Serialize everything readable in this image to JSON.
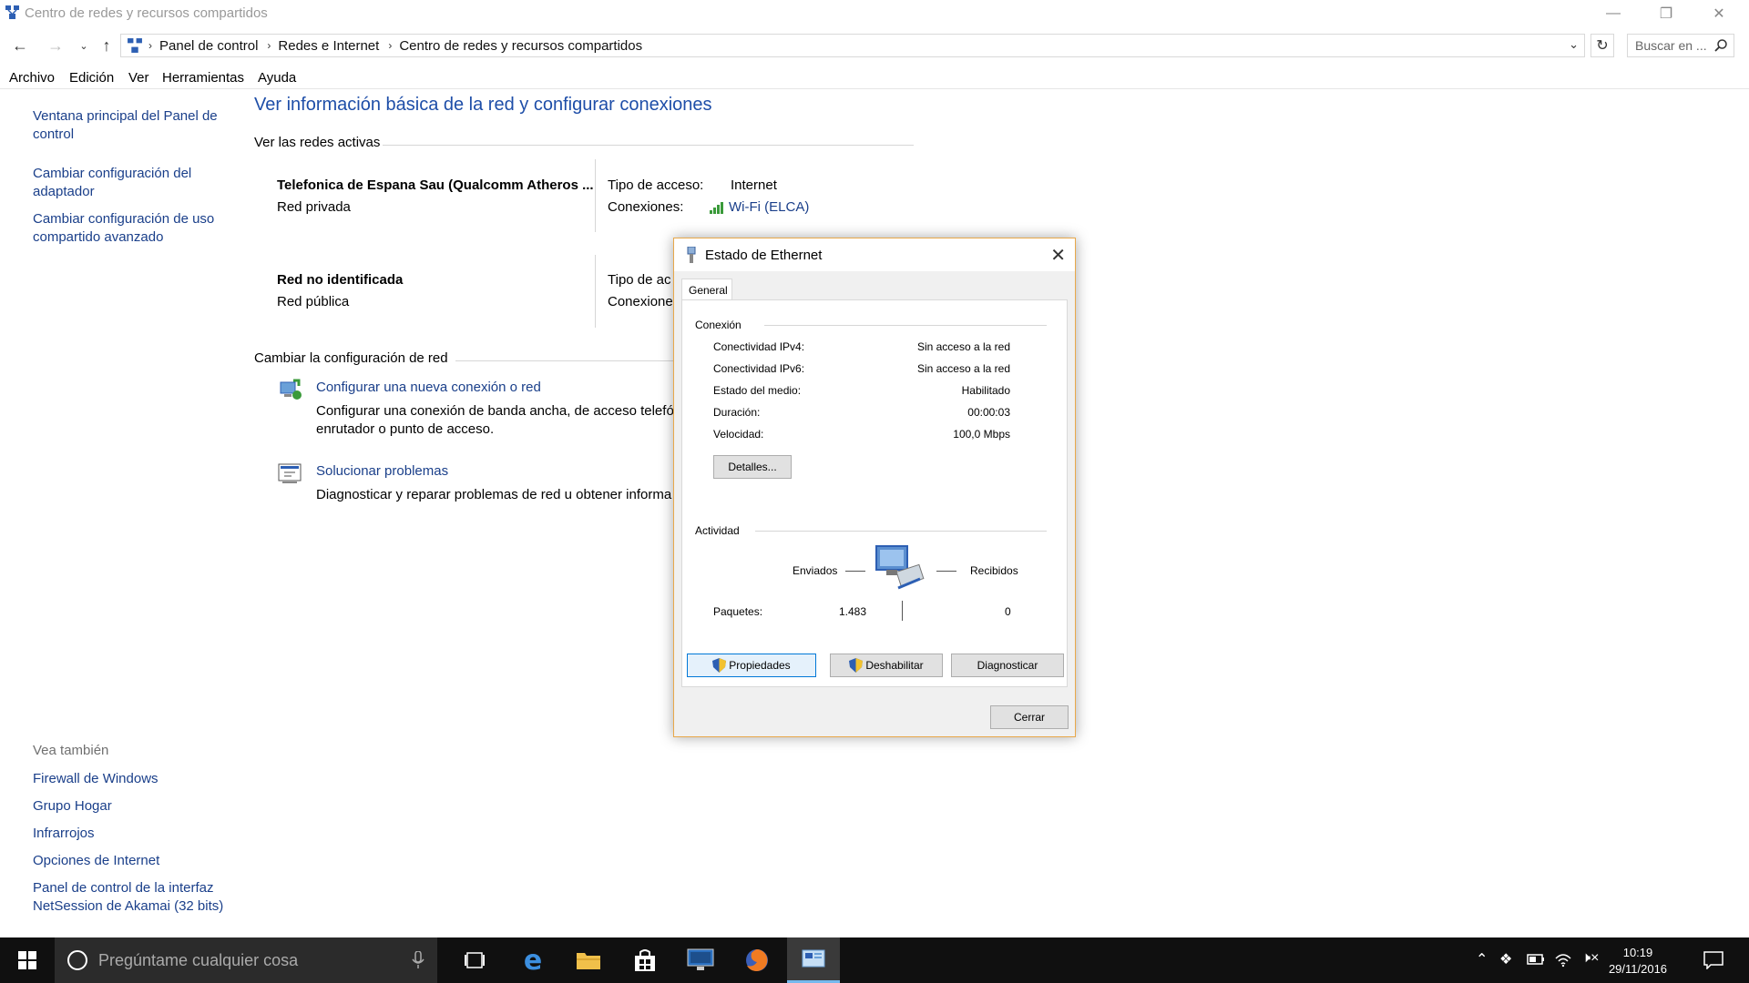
{
  "window": {
    "title": "Centro de redes y recursos compartidos"
  },
  "address": {
    "breadcrumbs": [
      "Panel de control",
      "Redes e Internet",
      "Centro de redes y recursos compartidos"
    ],
    "search_placeholder": "Buscar en ..."
  },
  "menu": [
    "Archivo",
    "Edición",
    "Ver",
    "Herramientas",
    "Ayuda"
  ],
  "sidebar": {
    "links": [
      "Ventana principal del Panel de control",
      "Cambiar configuración del adaptador",
      "Cambiar configuración de uso compartido avanzado"
    ],
    "see_also_label": "Vea también",
    "see_also": [
      "Firewall de Windows",
      "Grupo Hogar",
      "Infrarrojos",
      "Opciones de Internet",
      "Panel de control de la interfaz NetSession de Akamai (32 bits)"
    ]
  },
  "main": {
    "title": "Ver información básica de la red y configurar conexiones",
    "active_networks_header": "Ver las redes activas",
    "networks": [
      {
        "name": "Telefonica de Espana Sau (Qualcomm Atheros ...",
        "type": "Red privada",
        "access_label": "Tipo de acceso:",
        "access_value": "Internet",
        "connections_label": "Conexiones:",
        "connections_value": "Wi-Fi (ELCA)"
      },
      {
        "name": "Red no identificada",
        "type": "Red pública",
        "access_label": "Tipo de ac",
        "connections_label": "Conexiones"
      }
    ],
    "change_config_header": "Cambiar la configuración de red",
    "tasks": [
      {
        "link": "Configurar una nueva conexión o red",
        "desc_line1": "Configurar una conexión de banda ancha, de acceso telefó",
        "desc_line2": "enrutador o punto de acceso."
      },
      {
        "link": "Solucionar problemas",
        "desc_line1": "Diagnosticar y reparar problemas de red u obtener informa"
      }
    ]
  },
  "dialog": {
    "title": "Estado de Ethernet",
    "tab": "General",
    "connection_group": "Conexión",
    "rows": [
      {
        "label": "Conectividad IPv4:",
        "value": "Sin acceso a la red"
      },
      {
        "label": "Conectividad IPv6:",
        "value": "Sin acceso a la red"
      },
      {
        "label": "Estado del medio:",
        "value": "Habilitado"
      },
      {
        "label": "Duración:",
        "value": "00:00:03"
      },
      {
        "label": "Velocidad:",
        "value": "100,0 Mbps"
      }
    ],
    "details_button": "Detalles...",
    "activity_group": "Actividad",
    "sent_label": "Enviados",
    "received_label": "Recibidos",
    "packets_label": "Paquetes:",
    "packets_sent": "1.483",
    "packets_received": "0",
    "properties_button": "Propiedades",
    "disable_button": "Deshabilitar",
    "diagnose_button": "Diagnosticar",
    "close_button": "Cerrar"
  },
  "taskbar": {
    "search_placeholder": "Pregúntame cualquier cosa",
    "time": "10:19",
    "date": "29/11/2016"
  },
  "colors": {
    "link": "#1a3f8a",
    "title_blue": "#1e4ea8",
    "dialog_border": "#e8a84a",
    "taskbar": "#101010"
  }
}
